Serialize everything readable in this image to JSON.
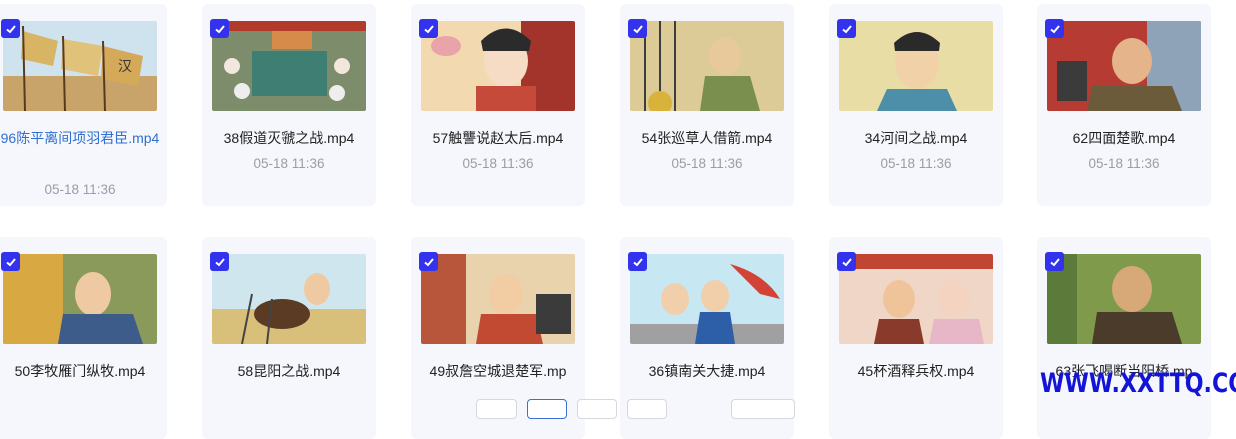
{
  "videos_row1": [
    {
      "title": "96陈平离间项羽君臣.mp4",
      "date": "05-18 11:36",
      "checked": true,
      "active": true
    },
    {
      "title": "38假道灭虢之战.mp4",
      "date": "05-18 11:36",
      "checked": true
    },
    {
      "title": "57触讋说赵太后.mp4",
      "date": "05-18 11:36",
      "checked": true
    },
    {
      "title": "54张巡草人借箭.mp4",
      "date": "05-18 11:36",
      "checked": true
    },
    {
      "title": "34河间之战.mp4",
      "date": "05-18 11:36",
      "checked": true
    },
    {
      "title": "62四面楚歌.mp4",
      "date": "05-18 11:36",
      "checked": true
    }
  ],
  "videos_row2": [
    {
      "title": "50李牧雁门纵牧.mp4",
      "checked": true
    },
    {
      "title": "58昆阳之战.mp4",
      "checked": true
    },
    {
      "title": "49叔詹空城退楚军.mp",
      "checked": true
    },
    {
      "title": "36镇南关大捷.mp4",
      "checked": true
    },
    {
      "title": "45杯酒释兵权.mp4",
      "checked": true
    },
    {
      "title": "63张飞喝断当阳桥.mp",
      "checked": true
    }
  ],
  "watermark": "WWW.XXTTQ.COM",
  "icons": {
    "check": "checkmark-icon"
  },
  "colors": {
    "checkbox": "#3333ee",
    "active_title": "#2e6fd1",
    "card_bg": "#f6f7fc"
  }
}
